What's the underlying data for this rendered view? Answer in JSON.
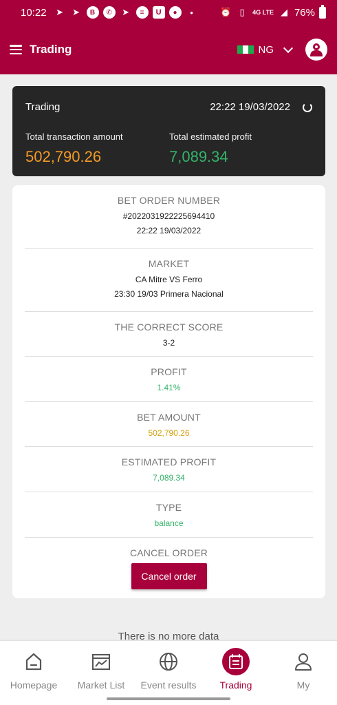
{
  "status_bar": {
    "time": "10:22",
    "network": "4G LTE",
    "battery": "76%"
  },
  "header": {
    "title": "Trading",
    "country_code": "NG",
    "accent_color": "#a8003a"
  },
  "summary": {
    "title": "Trading",
    "datetime": "22:22 19/03/2022",
    "total_amount_label": "Total transaction amount",
    "total_amount": "502,790.26",
    "total_profit_label": "Total estimated profit",
    "total_profit": "7,089.34"
  },
  "order": {
    "order_number_label": "BET ORDER NUMBER",
    "order_number": "#2022031922225694410",
    "order_time": "22:22 19/03/2022",
    "market_label": "MARKET",
    "market_teams": "CA Mitre VS Ferro",
    "market_detail": "23:30 19/03 Primera Nacional",
    "score_label": "THE CORRECT SCORE",
    "score": "3-2",
    "profit_label": "PROFIT",
    "profit": "1.41%",
    "bet_amount_label": "BET AMOUNT",
    "bet_amount": "502,790.26",
    "est_profit_label": "ESTIMATED PROFIT",
    "est_profit": "7,089.34",
    "type_label": "TYPE",
    "type": "balance",
    "cancel_label": "CANCEL ORDER",
    "cancel_button": "Cancel order"
  },
  "footer_note": "There is no more data",
  "bottom_nav": {
    "items": [
      {
        "label": "Homepage",
        "icon": "home-icon"
      },
      {
        "label": "Market List",
        "icon": "chart-icon"
      },
      {
        "label": "Event results",
        "icon": "ball-icon"
      },
      {
        "label": "Trading",
        "icon": "calendar-icon"
      },
      {
        "label": "My",
        "icon": "user-icon"
      }
    ],
    "active": "Trading"
  }
}
